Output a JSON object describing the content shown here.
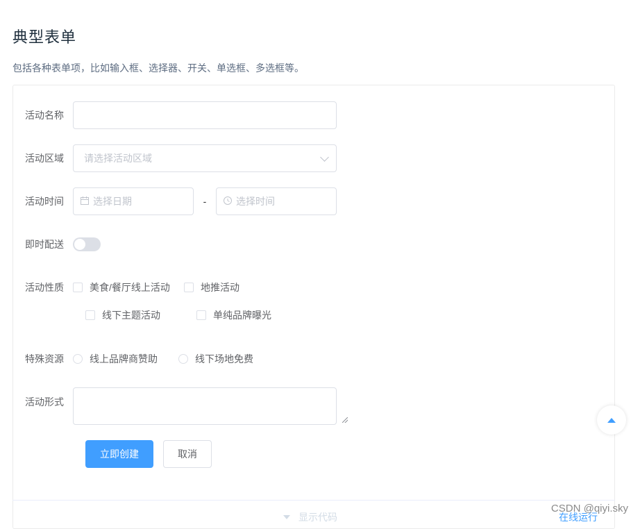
{
  "page": {
    "title": "典型表单",
    "description": "包括各种表单项，比如输入框、选择器、开关、单选框、多选框等。"
  },
  "form": {
    "name": {
      "label": "活动名称",
      "value": ""
    },
    "region": {
      "label": "活动区域",
      "placeholder": "请选择活动区域"
    },
    "time": {
      "label": "活动时间",
      "date_placeholder": "选择日期",
      "separator": "-",
      "time_placeholder": "选择时间"
    },
    "delivery": {
      "label": "即时配送",
      "on": false
    },
    "type": {
      "label": "活动性质",
      "options": [
        "美食/餐厅线上活动",
        "地推活动",
        "线下主题活动",
        "单纯品牌曝光"
      ]
    },
    "resource": {
      "label": "特殊资源",
      "options": [
        "线上品牌商赞助",
        "线下场地免费"
      ]
    },
    "desc": {
      "label": "活动形式",
      "value": ""
    },
    "buttons": {
      "create": "立即创建",
      "cancel": "取消"
    }
  },
  "footer": {
    "show_code": "显示代码",
    "run_online": "在线运行"
  },
  "watermark": "CSDN @qiyi.sky",
  "icons": {
    "calendar": "calendar-icon",
    "clock": "clock-icon",
    "back_to_top": "caret-up-icon"
  },
  "colors": {
    "primary": "#409eff",
    "border": "#dcdfe6",
    "title": "#1f2f3d"
  }
}
